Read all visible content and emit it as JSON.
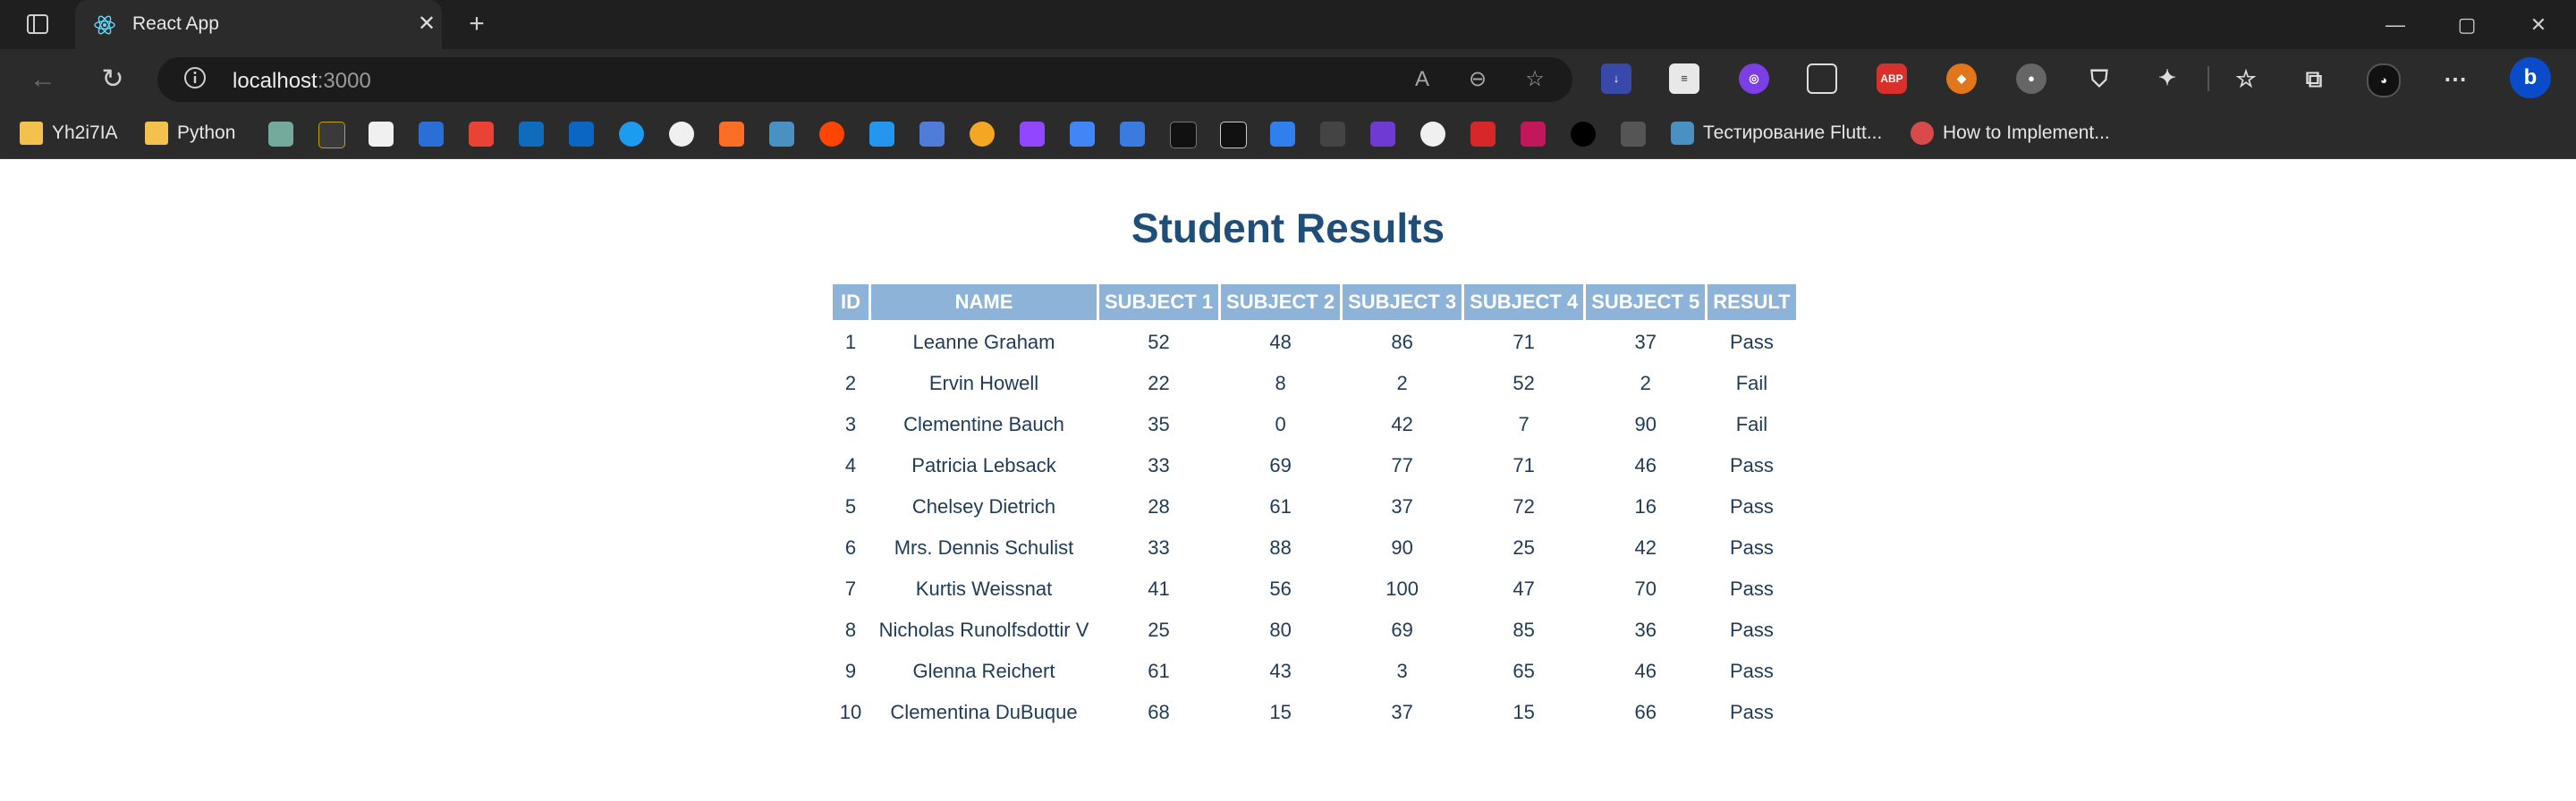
{
  "browser": {
    "tab": {
      "title": "React App"
    },
    "address": {
      "host": "localhost",
      "port": ":3000"
    },
    "bookmarks": [
      {
        "label": "Yh2i7IA",
        "icon": "folder-icon"
      },
      {
        "label": "Python",
        "icon": "folder-icon"
      },
      {
        "label": "Тестирование Flutt...",
        "icon": "site-favicon-icon"
      },
      {
        "label": "How to Implement...",
        "icon": "site-favicon-icon"
      }
    ]
  },
  "page": {
    "title": "Student Results",
    "table": {
      "headers": [
        "ID",
        "NAME",
        "SUBJECT 1",
        "SUBJECT 2",
        "SUBJECT 3",
        "SUBJECT 4",
        "SUBJECT 5",
        "RESULT"
      ],
      "rows": [
        [
          "1",
          "Leanne Graham",
          "52",
          "48",
          "86",
          "71",
          "37",
          "Pass"
        ],
        [
          "2",
          "Ervin Howell",
          "22",
          "8",
          "2",
          "52",
          "2",
          "Fail"
        ],
        [
          "3",
          "Clementine Bauch",
          "35",
          "0",
          "42",
          "7",
          "90",
          "Fail"
        ],
        [
          "4",
          "Patricia Lebsack",
          "33",
          "69",
          "77",
          "71",
          "46",
          "Pass"
        ],
        [
          "5",
          "Chelsey Dietrich",
          "28",
          "61",
          "37",
          "72",
          "16",
          "Pass"
        ],
        [
          "6",
          "Mrs. Dennis Schulist",
          "33",
          "88",
          "90",
          "25",
          "42",
          "Pass"
        ],
        [
          "7",
          "Kurtis Weissnat",
          "41",
          "56",
          "100",
          "47",
          "70",
          "Pass"
        ],
        [
          "8",
          "Nicholas Runolfsdottir V",
          "25",
          "80",
          "69",
          "85",
          "36",
          "Pass"
        ],
        [
          "9",
          "Glenna Reichert",
          "61",
          "43",
          "3",
          "65",
          "46",
          "Pass"
        ],
        [
          "10",
          "Clementina DuBuque",
          "68",
          "15",
          "37",
          "15",
          "66",
          "Pass"
        ]
      ]
    }
  },
  "colors": {
    "header_bg": "#8db3d8",
    "title_color": "#1f4e79",
    "text_color": "#1f3b5a"
  }
}
